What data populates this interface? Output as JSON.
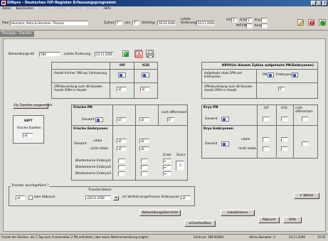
{
  "window": {
    "title": "DIRpro - Deutsches IVF-Register Erfassungsprogramm",
    "minimize": "_",
    "maximize": "□",
    "close": "x"
  },
  "menu": {
    "items": [
      "Datei",
      "Bearbeiten",
      "Daten",
      "Ansicht",
      "Extras",
      "Fenster",
      "Hilfe"
    ]
  },
  "header": {
    "paar_label": "Paar",
    "paar_value": "Hermann, Petra & Hermann, Thomas",
    "zyklus_label": "Zyklus",
    "zyklus_value": "7",
    "von_label": "von",
    "von_value": "7",
    "stichtag_label": "Stichtag",
    "stichtag_value": "28.03.2006",
    "letzte_label": "Letzte Änderung",
    "letzte_value": "24.11.2006",
    "ivf_label": "IVF",
    "ivf_value": "1",
    "icsi_label": "ICSI",
    "icsi_value": "1",
    "kryo_label": "Kryo",
    "kryo_value": "",
    "mtcn_label": "M/TCN",
    "mtcn_value": "",
    "keine_label": "Keine",
    "keine_value": ""
  },
  "section_tab": "Therapie - Transfer",
  "record": {
    "id_label": "Behandlungs-ID",
    "id_value": "589",
    "changed_label": "Letzte Änderung",
    "changed_value": "24.11.2006"
  },
  "left_table": {
    "col_ivf": "IVF",
    "col_icsi": "ICSI",
    "row1": "Anzahl frischer 2PN aus Fußmessung",
    "row2": "2PN Beurteilung nach 48 Stunden Anzahl 2PN's in Anzahl"
  },
  "kryo_box": {
    "title": "KRYO(in diesem Zyklus aufgetaute PN/Embryonen)",
    "row1": "Aufgetaute vitale 2PN und Embryonen",
    "pn_label": "PN",
    "emb_label": "Embryonen",
    "row2": "2PN Beurteilung nach 48 Stunden Anzahl 2PN's in Anzahl"
  },
  "transfer_tab": "Für Transfer vorgesehen",
  "gift": {
    "title": "GIFT",
    "sub": "frische Eizellen"
  },
  "frische_pn": {
    "title": "Frische PN",
    "gesamt": "Gesamt",
    "nicht": "nicht differenziert"
  },
  "frische_emb": {
    "title": "Frische Embryonen",
    "vitale": "vitale",
    "nicht_vitale": "nicht vitale",
    "b1": "Blastomeren Embryo1",
    "b2": "Blastomeren Embryo2",
    "b3": "Blastomeren Embryo3",
    "grad": "Grad",
    "score": "Score"
  },
  "kryo_pn": {
    "title": "Kryo PN",
    "gesamt": "Gesamt",
    "col_ivf": "IVF",
    "col_icsi": "ICSI",
    "nicht": "nicht differenziert"
  },
  "kryo_emb": {
    "title": "Kryo Embryonen",
    "gesamt": "Gesamt",
    "vitale": "vitale",
    "nicht_vitale": "nicht vitale"
  },
  "transfer": {
    "question": "Transfer durchgeführt ?",
    "kein_abbruch": "kein Abbruch",
    "datum_label": "Transferdatum",
    "datum_value": "28.01.2006",
    "eingefroren": "im Vorfeld eingefrorene Embryonen"
  },
  "buttons": {
    "weiter": "Weiter",
    "behandlungsuebersicht": "Behandlungsübersicht",
    "lokalphase": "Lokalphase ▸",
    "abbruch": "Abbruch",
    "hilfe": "Hilfe",
    "eizellaufbau": "◂ Eizellaufbau"
  },
  "status": {
    "message": "Anzahl der Eizellen, die 1 Tag nach Insemination 2 PN enthielten, aber keine Weiterentwicklung zeigten",
    "zentrum": "Zentrum: 188 KURKA",
    "benutzer": "Aktive Benutzer: 2",
    "datum": "24.11.2006",
    "zeit": "15:55"
  },
  "values": {
    "red": "0",
    "blue": "1",
    "score": "0"
  },
  "colors": {
    "titlebar": "#0a246a",
    "panel": "#e4e4e0",
    "arrow": "#d00",
    "blue": "#3b4fd0"
  }
}
